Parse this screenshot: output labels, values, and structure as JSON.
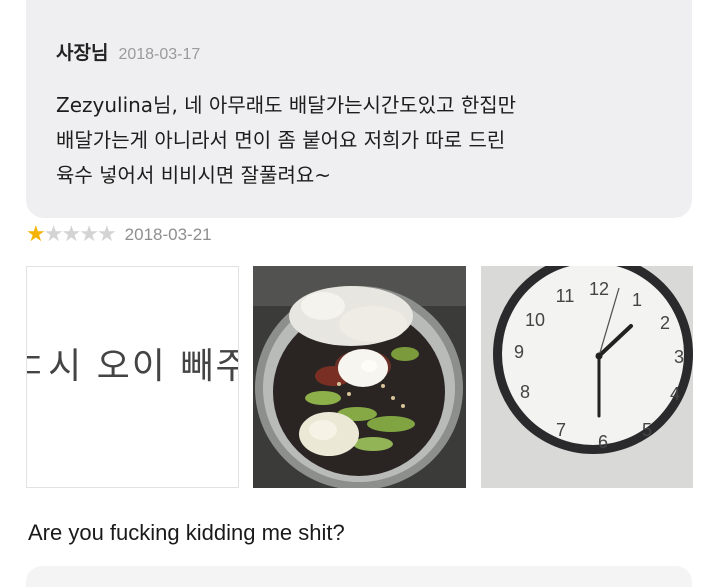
{
  "reply": {
    "author": "사장님",
    "date": "2018-03-17",
    "lines": [
      "Zezyulina님, 네 아무래도 배달가는시간도있고 한집만",
      "배달가는게 아니라서  면이 좀 붙어요 저희가 따로 드린",
      "육수 넣어서 비비시면 잘풀려요~"
    ]
  },
  "review": {
    "rating": 1,
    "max_rating": 5,
    "date": "2018-03-21",
    "photo_1_text": "ㄷ시 오이 빼주",
    "clock_numbers": [
      "12",
      "1",
      "2",
      "3",
      "4",
      "5",
      "6",
      "7",
      "8",
      "9",
      "10",
      "11"
    ],
    "comment": "Are you fucking kidding me shit?"
  },
  "colors": {
    "reply_bg": "#efeff1",
    "star_on": "#f5b301",
    "star_off": "#d4d4d4"
  }
}
